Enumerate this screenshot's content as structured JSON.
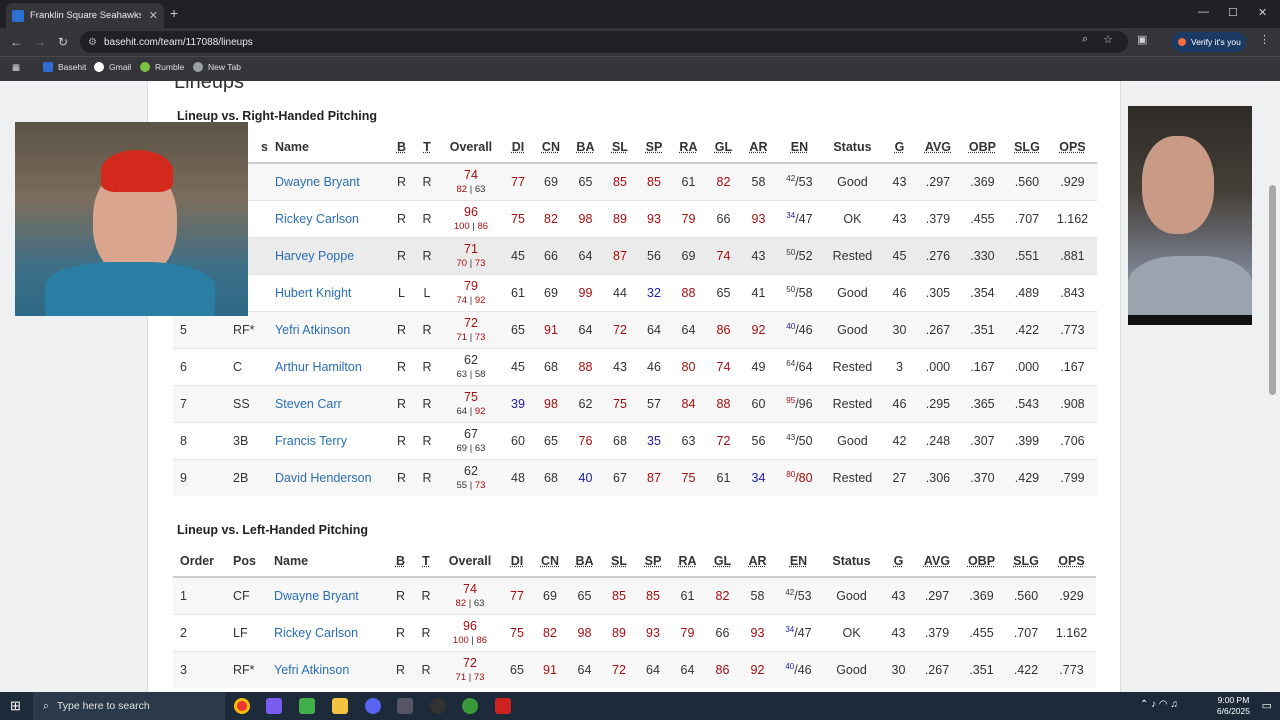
{
  "browser": {
    "tab_title": "Franklin Square Seahawks: Line",
    "url": "basehit.com/team/117088/lineups",
    "verify_label": "Verify it's you",
    "bookmarks": [
      "Basehit",
      "Gmail",
      "Rumble",
      "New Tab"
    ]
  },
  "page": {
    "title": "Lineups",
    "sections": [
      {
        "title": "Lineup vs. Right-Handed Pitching"
      },
      {
        "title": "Lineup vs. Left-Handed Pitching"
      }
    ]
  },
  "columns": [
    "Order",
    "Pos",
    "Name",
    "B",
    "T",
    "Overall",
    "DI",
    "CN",
    "BA",
    "SL",
    "SP",
    "RA",
    "GL",
    "AR",
    "EN",
    "Status",
    "G",
    "AVG",
    "OBP",
    "SLG",
    "OPS"
  ],
  "column_visible_fragments": {
    "pos_partial": "s"
  },
  "colors": {
    "high": "#a50e0e",
    "low": "#1c1ca3",
    "link": "#2a6fb5"
  },
  "rhp": [
    {
      "order": "",
      "pos": "",
      "name": "Dwayne Bryant",
      "b": "R",
      "t": "R",
      "ov": "74",
      "ov_a": "82",
      "ov_b": "63",
      "di": "77",
      "cn": "69",
      "ba": "65",
      "sl": "85",
      "sp": "85",
      "ra": "61",
      "gl": "82",
      "ar": "58",
      "en_sup": "42",
      "en": "/53",
      "status": "Good",
      "g": "43",
      "avg": ".297",
      "obp": ".369",
      "slg": ".560",
      "ops": ".929"
    },
    {
      "order": "",
      "pos": "",
      "name": "Rickey Carlson",
      "b": "R",
      "t": "R",
      "ov": "96",
      "ov_a": "100",
      "ov_b": "86",
      "di": "75",
      "cn": "82",
      "ba": "98",
      "sl": "89",
      "sp": "93",
      "ra": "79",
      "gl": "66",
      "ar": "93",
      "en_sup": "34",
      "en": "/47",
      "status": "OK",
      "g": "43",
      "avg": ".379",
      "obp": ".455",
      "slg": ".707",
      "ops": "1.162"
    },
    {
      "order": "",
      "pos": "",
      "name": "Harvey Poppe",
      "b": "R",
      "t": "R",
      "ov": "71",
      "ov_a": "70",
      "ov_b": "73",
      "di": "45",
      "cn": "66",
      "ba": "64",
      "sl": "87",
      "sp": "56",
      "ra": "69",
      "gl": "74",
      "ar": "43",
      "en_sup": "50",
      "en": "/52",
      "status": "Rested",
      "g": "45",
      "avg": ".276",
      "obp": ".330",
      "slg": ".551",
      "ops": ".881"
    },
    {
      "order": "",
      "pos": "",
      "name": "Hubert Knight",
      "b": "L",
      "t": "L",
      "ov": "79",
      "ov_a": "74",
      "ov_b": "92",
      "di": "61",
      "cn": "69",
      "ba": "99",
      "sl": "44",
      "sp": "32",
      "ra": "88",
      "gl": "65",
      "ar": "41",
      "en_sup": "50",
      "en": "/58",
      "status": "Good",
      "g": "46",
      "avg": ".305",
      "obp": ".354",
      "slg": ".489",
      "ops": ".843"
    },
    {
      "order": "5",
      "pos": "RF*",
      "name": "Yefri Atkinson",
      "b": "R",
      "t": "R",
      "ov": "72",
      "ov_a": "71",
      "ov_b": "73",
      "di": "65",
      "cn": "91",
      "ba": "64",
      "sl": "72",
      "sp": "64",
      "ra": "64",
      "gl": "86",
      "ar": "92",
      "en_sup": "40",
      "en": "/46",
      "status": "Good",
      "g": "30",
      "avg": ".267",
      "obp": ".351",
      "slg": ".422",
      "ops": ".773"
    },
    {
      "order": "6",
      "pos": "C",
      "name": "Arthur Hamilton",
      "b": "R",
      "t": "R",
      "ov": "62",
      "ov_a": "63",
      "ov_b": "58",
      "di": "45",
      "cn": "68",
      "ba": "88",
      "sl": "43",
      "sp": "46",
      "ra": "80",
      "gl": "74",
      "ar": "49",
      "en_sup": "64",
      "en": "/64",
      "status": "Rested",
      "g": "3",
      "avg": ".000",
      "obp": ".167",
      "slg": ".000",
      "ops": ".167"
    },
    {
      "order": "7",
      "pos": "SS",
      "name": "Steven Carr",
      "b": "R",
      "t": "R",
      "ov": "75",
      "ov_a": "64",
      "ov_b": "92",
      "di": "39",
      "cn": "98",
      "ba": "62",
      "sl": "75",
      "sp": "57",
      "ra": "84",
      "gl": "88",
      "ar": "60",
      "en_sup": "95",
      "en": "/96",
      "status": "Rested",
      "g": "46",
      "avg": ".295",
      "obp": ".365",
      "slg": ".543",
      "ops": ".908"
    },
    {
      "order": "8",
      "pos": "3B",
      "name": "Francis Terry",
      "b": "R",
      "t": "R",
      "ov": "67",
      "ov_a": "69",
      "ov_b": "63",
      "di": "60",
      "cn": "65",
      "ba": "76",
      "sl": "68",
      "sp": "35",
      "ra": "63",
      "gl": "72",
      "ar": "56",
      "en_sup": "43",
      "en": "/50",
      "status": "Good",
      "g": "42",
      "avg": ".248",
      "obp": ".307",
      "slg": ".399",
      "ops": ".706"
    },
    {
      "order": "9",
      "pos": "2B",
      "name": "David Henderson",
      "b": "R",
      "t": "R",
      "ov": "62",
      "ov_a": "55",
      "ov_b": "73",
      "di": "48",
      "cn": "68",
      "ba": "40",
      "sl": "67",
      "sp": "87",
      "ra": "75",
      "gl": "61",
      "ar": "34",
      "en_sup": "80",
      "en": "/80",
      "status": "Rested",
      "g": "27",
      "avg": ".306",
      "obp": ".370",
      "slg": ".429",
      "ops": ".799"
    }
  ],
  "lhp": [
    {
      "order": "1",
      "pos": "CF",
      "name": "Dwayne Bryant",
      "b": "R",
      "t": "R",
      "ov": "74",
      "ov_a": "82",
      "ov_b": "63",
      "di": "77",
      "cn": "69",
      "ba": "65",
      "sl": "85",
      "sp": "85",
      "ra": "61",
      "gl": "82",
      "ar": "58",
      "en_sup": "42",
      "en": "/53",
      "status": "Good",
      "g": "43",
      "avg": ".297",
      "obp": ".369",
      "slg": ".560",
      "ops": ".929"
    },
    {
      "order": "2",
      "pos": "LF",
      "name": "Rickey Carlson",
      "b": "R",
      "t": "R",
      "ov": "96",
      "ov_a": "100",
      "ov_b": "86",
      "di": "75",
      "cn": "82",
      "ba": "98",
      "sl": "89",
      "sp": "93",
      "ra": "79",
      "gl": "66",
      "ar": "93",
      "en_sup": "34",
      "en": "/47",
      "status": "OK",
      "g": "43",
      "avg": ".379",
      "obp": ".455",
      "slg": ".707",
      "ops": "1.162"
    },
    {
      "order": "3",
      "pos": "RF*",
      "name": "Yefri Atkinson",
      "b": "R",
      "t": "R",
      "ov": "72",
      "ov_a": "71",
      "ov_b": "73",
      "di": "65",
      "cn": "91",
      "ba": "64",
      "sl": "72",
      "sp": "64",
      "ra": "64",
      "gl": "86",
      "ar": "92",
      "en_sup": "40",
      "en": "/46",
      "status": "Good",
      "g": "30",
      "avg": ".267",
      "obp": ".351",
      "slg": ".422",
      "ops": ".773"
    }
  ],
  "taskbar": {
    "search_placeholder": "Type here to search",
    "time": "9:00 PM",
    "date": "6/6/2025"
  }
}
